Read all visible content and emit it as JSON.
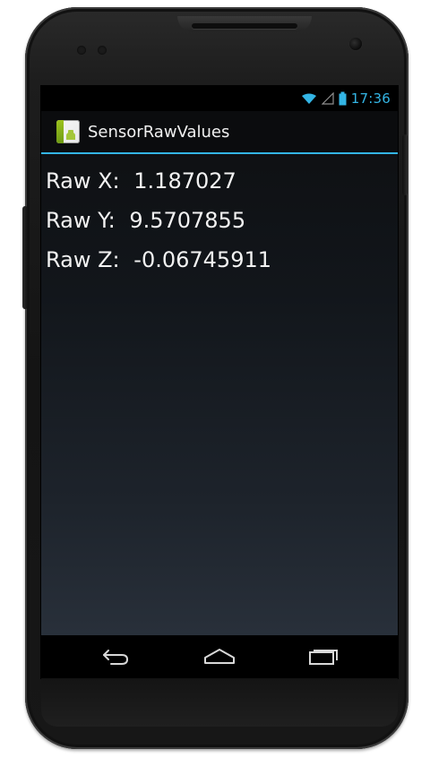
{
  "status_bar": {
    "time": "17:36",
    "accent_color": "#33b5e5",
    "icons": [
      "wifi-icon",
      "signal-icon",
      "battery-icon"
    ]
  },
  "app": {
    "title": "SensorRawValues",
    "icon": "android-app-icon"
  },
  "sensor": {
    "x_label": "Raw X:",
    "x_value": "1.187027",
    "y_label": "Raw Y:",
    "y_value": "9.5707855",
    "z_label": "Raw Z:",
    "z_value": "-0.06745911"
  },
  "navigation": {
    "buttons": [
      "back-icon",
      "home-icon",
      "recent-apps-icon"
    ]
  }
}
